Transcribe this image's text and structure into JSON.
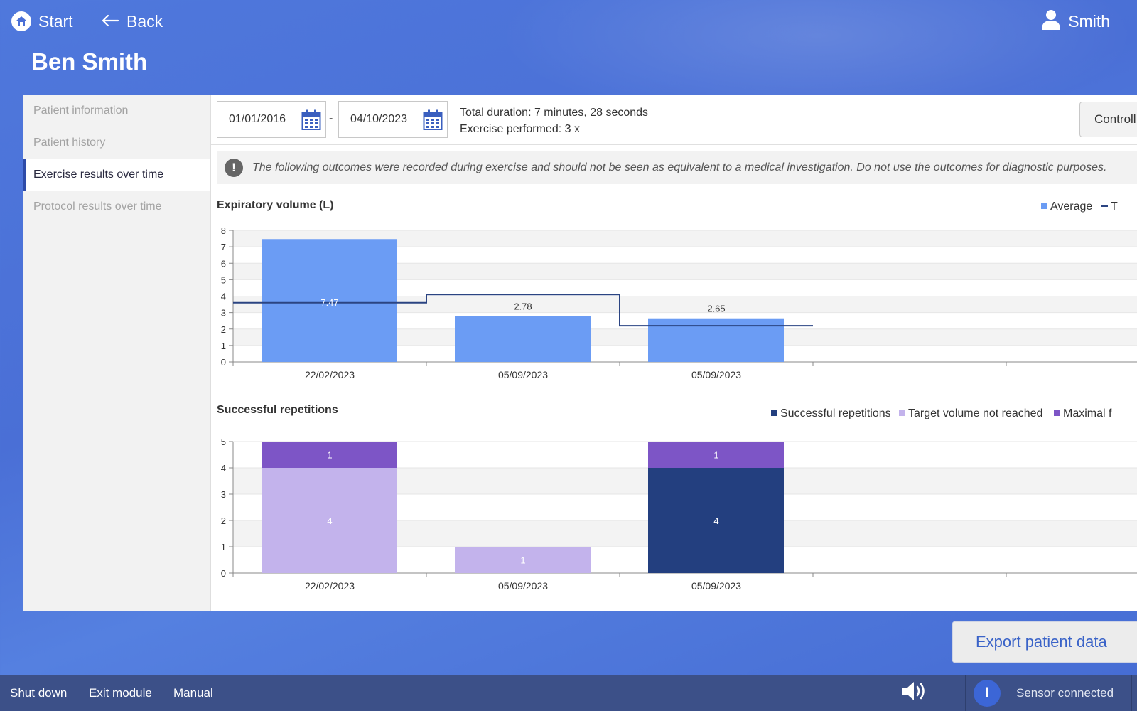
{
  "header": {
    "start_label": "Start",
    "back_label": "Back",
    "user_label": "Smith"
  },
  "page_title": "Ben Smith",
  "sidebar": {
    "items": [
      {
        "label": "Patient information",
        "active": false
      },
      {
        "label": "Patient history",
        "active": false
      },
      {
        "label": "Exercise results over time",
        "active": true
      },
      {
        "label": "Protocol results over time",
        "active": false
      }
    ]
  },
  "filters": {
    "date_from": "01/01/2016",
    "date_separator": "-",
    "date_to": "04/10/2023",
    "controls_label": "Controll"
  },
  "summary": {
    "total_duration": "Total duration: 7 minutes, 28 seconds",
    "exercise_performed": "Exercise performed: 3 x"
  },
  "notice": {
    "icon": "!",
    "text": "The following outcomes were recorded during exercise and should not be seen as equivalent to a medical investigation. Do not use the outcomes for diagnostic purposes."
  },
  "colors": {
    "average_bar": "#6b9cf4",
    "target_line": "#2b4482",
    "successful": "#233f7f",
    "target_not_reached": "#c3b3ec",
    "maximal": "#7d55c6",
    "accent": "#3c66d6"
  },
  "chart_data": [
    {
      "type": "bar",
      "title": "Expiratory volume (L)",
      "categories": [
        "22/02/2023",
        "05/09/2023",
        "05/09/2023"
      ],
      "series": [
        {
          "name": "Average",
          "values": [
            7.47,
            2.78,
            2.65
          ],
          "data_labels": [
            "7.47",
            "2.78",
            "2.65"
          ]
        },
        {
          "name": "T",
          "type": "step-line",
          "values": [
            3.6,
            4.1,
            2.2
          ]
        }
      ],
      "y_ticks": [
        "0",
        "1",
        "2",
        "3",
        "4",
        "5",
        "6",
        "7",
        "8"
      ],
      "ylim": [
        0,
        8
      ],
      "grid": true,
      "legend": "top-right",
      "legend_labels": [
        "Average",
        "T"
      ]
    },
    {
      "type": "bar",
      "stacked": true,
      "title": "Successful repetitions",
      "categories": [
        "22/02/2023",
        "05/09/2023",
        "05/09/2023"
      ],
      "series": [
        {
          "name": "Successful repetitions",
          "values": [
            0,
            0,
            4
          ]
        },
        {
          "name": "Target volume not reached",
          "values": [
            4,
            1,
            0
          ]
        },
        {
          "name": "Maximal f",
          "values": [
            1,
            0,
            1
          ]
        }
      ],
      "y_ticks": [
        "0",
        "1",
        "2",
        "3",
        "4",
        "5"
      ],
      "ylim": [
        0,
        5
      ],
      "grid": true,
      "legend": "top-right",
      "legend_labels": [
        "Successful repetitions",
        "Target volume not reached",
        "Maximal f"
      ]
    }
  ],
  "export_label": "Export patient data",
  "footer": {
    "shutdown_label": "Shut down",
    "exit_label": "Exit module",
    "manual_label": "Manual",
    "sensor_icon_text": "I",
    "sensor_label": "Sensor connected"
  }
}
